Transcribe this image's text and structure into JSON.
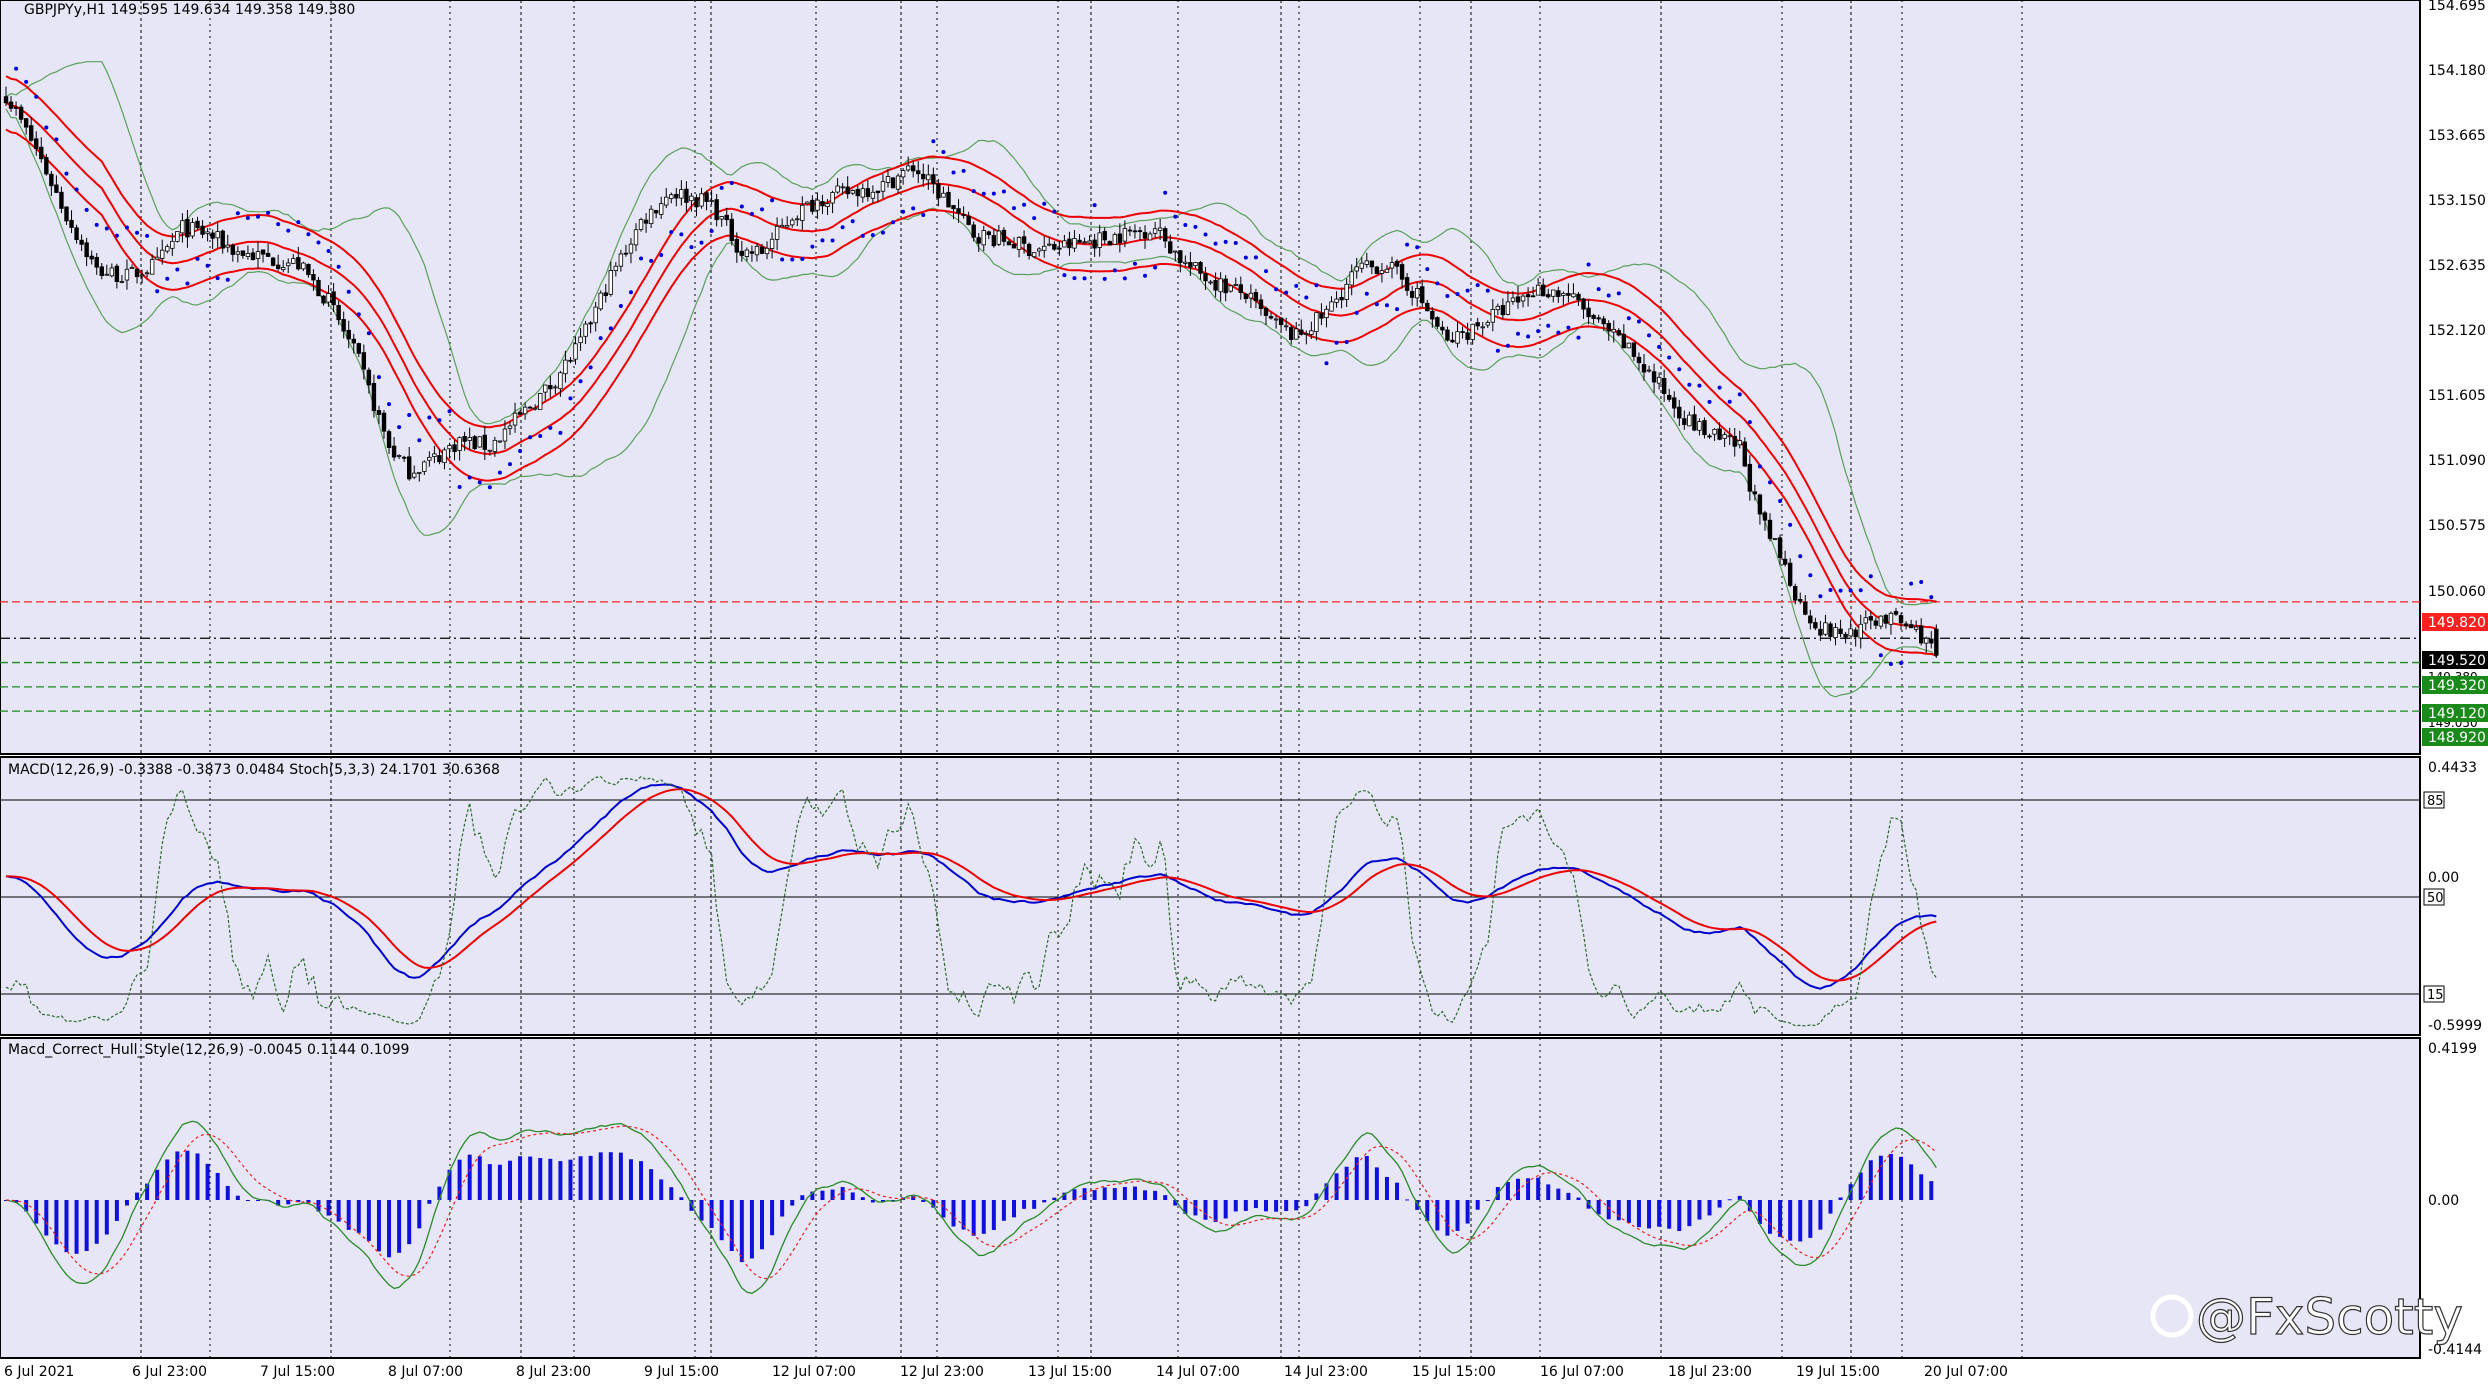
{
  "main": {
    "header": "GBPJPYy,H1  149.595 149.634 149.358 149.380",
    "price_labels": [
      "154.695",
      "154.180",
      "153.665",
      "153.150",
      "152.635",
      "152.120",
      "151.605",
      "151.090",
      "150.575",
      "150.060"
    ],
    "hlines": [
      {
        "value": "149.820",
        "color": "#ff2020",
        "style": "dash"
      },
      {
        "value": "149.520",
        "color": "#000000",
        "style": "dashdot"
      },
      {
        "value": "149.320",
        "color": "#1a8a1a",
        "style": "dash"
      },
      {
        "value": "149.120",
        "color": "#1a8a1a",
        "style": "dash"
      },
      {
        "value": "148.920",
        "color": "#1a8a1a",
        "style": "dash"
      }
    ],
    "hidden_tick_fragments": [
      "149.380",
      "149.050"
    ]
  },
  "indicator1": {
    "header": "MACD(12,26,9) -0.3388 -0.3873 0.0484  Stoch(5,3,3) 24.1701 30.6368",
    "scale_labels": [
      "0.4433",
      "0.00",
      "-0.5999"
    ],
    "level_labels": [
      "85",
      "50",
      "15"
    ]
  },
  "indicator2": {
    "header": "Macd_Correct_Hull_Style(12,26,9) -0.0045 0.1144 0.1099",
    "scale_labels": [
      "0.4199",
      "0.00",
      "-0.4144"
    ]
  },
  "x_labels": [
    "6 Jul 2021",
    "6 Jul 23:00",
    "7 Jul 15:00",
    "8 Jul 07:00",
    "8 Jul 23:00",
    "9 Jul 15:00",
    "12 Jul 07:00",
    "12 Jul 23:00",
    "13 Jul 15:00",
    "14 Jul 07:00",
    "14 Jul 23:00",
    "15 Jul 15:00",
    "16 Jul 07:00",
    "18 Jul 23:00",
    "19 Jul 15:00",
    "20 Jul 07:00"
  ],
  "watermark": "@FxScotty",
  "colors": {
    "chart_bg": "#e6e6f6",
    "ma": "#ee0000",
    "bollinger": "#5aa05a",
    "parabolic_sar": "#0000dd",
    "macd_main": "#0000cc",
    "macd_signal": "#ee0000",
    "stoch": "#2a6a2a",
    "hull_hist": "#1010dd",
    "hull_line": "#2a8a2a",
    "hull_signal": "#ee2020"
  },
  "chart_data": {
    "type": "candlestick",
    "symbol": "GBPJPYy",
    "timeframe": "H1",
    "ohlc_header": {
      "open": 149.595,
      "high": 149.634,
      "low": 149.358,
      "close": 149.38
    },
    "ylim": [
      148.6,
      154.76
    ],
    "close_path": [
      [
        0,
        154.0
      ],
      [
        6,
        153.55
      ],
      [
        12,
        153.0
      ],
      [
        18,
        152.55
      ],
      [
        24,
        152.5
      ],
      [
        30,
        152.6
      ],
      [
        35,
        152.9
      ],
      [
        40,
        152.85
      ],
      [
        46,
        152.7
      ],
      [
        52,
        152.65
      ],
      [
        58,
        152.6
      ],
      [
        64,
        152.3
      ],
      [
        70,
        151.8
      ],
      [
        76,
        151.1
      ],
      [
        80,
        150.9
      ],
      [
        85,
        151.0
      ],
      [
        90,
        151.15
      ],
      [
        96,
        151.1
      ],
      [
        102,
        151.35
      ],
      [
        108,
        151.6
      ],
      [
        114,
        151.95
      ],
      [
        120,
        152.5
      ],
      [
        126,
        152.95
      ],
      [
        132,
        153.2
      ],
      [
        140,
        153.1
      ],
      [
        146,
        152.7
      ],
      [
        150,
        152.7
      ],
      [
        156,
        153.0
      ],
      [
        162,
        153.15
      ],
      [
        168,
        153.2
      ],
      [
        174,
        153.25
      ],
      [
        180,
        153.4
      ],
      [
        186,
        153.15
      ],
      [
        192,
        152.85
      ],
      [
        198,
        152.8
      ],
      [
        204,
        152.72
      ],
      [
        210,
        152.75
      ],
      [
        216,
        152.8
      ],
      [
        222,
        152.85
      ],
      [
        228,
        152.9
      ],
      [
        234,
        152.6
      ],
      [
        240,
        152.45
      ],
      [
        246,
        152.35
      ],
      [
        250,
        152.15
      ],
      [
        256,
        152.0
      ],
      [
        262,
        152.2
      ],
      [
        268,
        152.55
      ],
      [
        274,
        152.6
      ],
      [
        280,
        152.35
      ],
      [
        286,
        151.95
      ],
      [
        292,
        152.1
      ],
      [
        298,
        152.25
      ],
      [
        304,
        152.4
      ],
      [
        310,
        152.35
      ],
      [
        316,
        152.1
      ],
      [
        322,
        151.9
      ],
      [
        328,
        151.6
      ],
      [
        334,
        151.3
      ],
      [
        340,
        151.15
      ],
      [
        344,
        151.1
      ],
      [
        348,
        150.5
      ],
      [
        352,
        150.2
      ],
      [
        356,
        149.8
      ],
      [
        360,
        149.6
      ],
      [
        364,
        149.55
      ],
      [
        368,
        149.6
      ],
      [
        372,
        149.7
      ],
      [
        376,
        149.65
      ],
      [
        380,
        149.55
      ],
      [
        383,
        149.38
      ]
    ],
    "n_bars": 384
  }
}
